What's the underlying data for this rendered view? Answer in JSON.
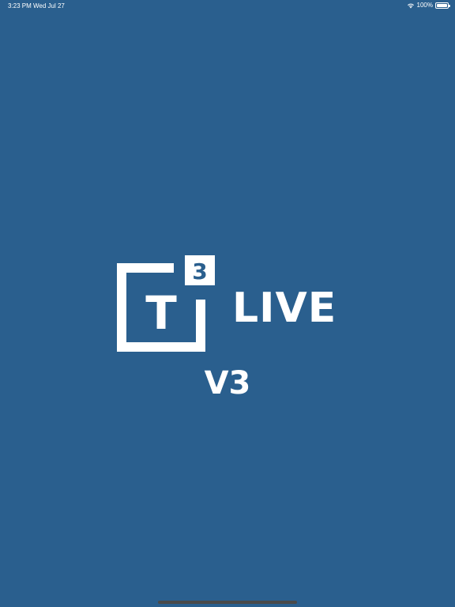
{
  "status_bar": {
    "time": "3:23 PM",
    "date": "Wed Jul 27",
    "battery_percent": "100%",
    "battery_level": 1.0,
    "icons": [
      "wifi-icon",
      "battery-icon"
    ]
  },
  "splash": {
    "logo_letter": "T",
    "logo_superscript": "3",
    "app_name": "LIVE",
    "version": "V3"
  },
  "colors": {
    "background": "#2a5f8e",
    "foreground": "#ffffff",
    "home_indicator": "#4a4a4a"
  }
}
